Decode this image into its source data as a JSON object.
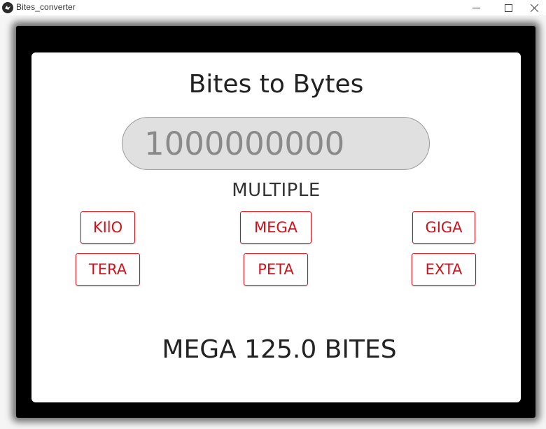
{
  "window": {
    "title": "Bites_converter",
    "icon": "kivy-app-icon",
    "controls": [
      "minimize-icon",
      "maximize-icon",
      "close-icon"
    ]
  },
  "app": {
    "heading": "Bites to Bytes",
    "input": {
      "value": "1000000000",
      "placeholder": ""
    },
    "multiple_label": "MULTIPLE",
    "buttons": [
      {
        "label": "KIlO"
      },
      {
        "label": "MEGA"
      },
      {
        "label": "GIGA"
      },
      {
        "label": "TERA"
      },
      {
        "label": "PETA"
      },
      {
        "label": "EXTA"
      }
    ],
    "result": "MEGA 125.0 BITES"
  },
  "colors": {
    "accent": "#d0121c",
    "frame": "#000000",
    "input_bg": "#e0e0e0",
    "text": "#222222"
  }
}
